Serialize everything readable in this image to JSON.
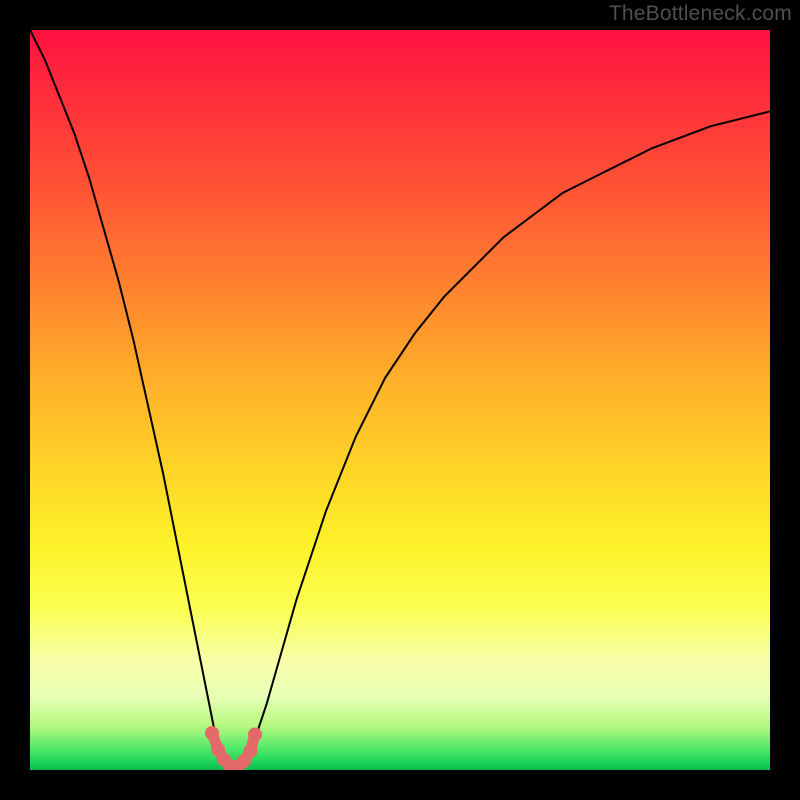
{
  "watermark": "TheBottleneck.com",
  "chart_data": {
    "type": "line",
    "title": "",
    "xlabel": "",
    "ylabel": "",
    "xlim": [
      0,
      100
    ],
    "ylim": [
      0,
      100
    ],
    "x": [
      0,
      2,
      4,
      6,
      8,
      10,
      12,
      14,
      16,
      18,
      20,
      22,
      24,
      25,
      26,
      27,
      28,
      29,
      30,
      32,
      34,
      36,
      38,
      40,
      44,
      48,
      52,
      56,
      60,
      64,
      68,
      72,
      76,
      80,
      84,
      88,
      92,
      96,
      100
    ],
    "values": [
      100,
      96,
      91,
      86,
      80,
      73,
      66,
      58,
      49,
      40,
      30,
      20,
      10,
      5,
      2,
      0.5,
      0,
      1,
      3,
      9,
      16,
      23,
      29,
      35,
      45,
      53,
      59,
      64,
      68,
      72,
      75,
      78,
      80,
      82,
      84,
      85.5,
      87,
      88,
      89
    ],
    "highlight_region": {
      "x_range": [
        24.5,
        30.5
      ],
      "y_range": [
        0,
        6
      ],
      "points_x": [
        24.6,
        25.4,
        26.2,
        27.0,
        28.0,
        28.9,
        29.8,
        30.4
      ],
      "points_y": [
        5.0,
        2.8,
        1.4,
        0.5,
        0.4,
        1.2,
        2.6,
        4.8
      ]
    },
    "background_gradient": {
      "top": "#ff1040",
      "mid": "#ffd628",
      "bottom": "#0aba4c"
    }
  }
}
